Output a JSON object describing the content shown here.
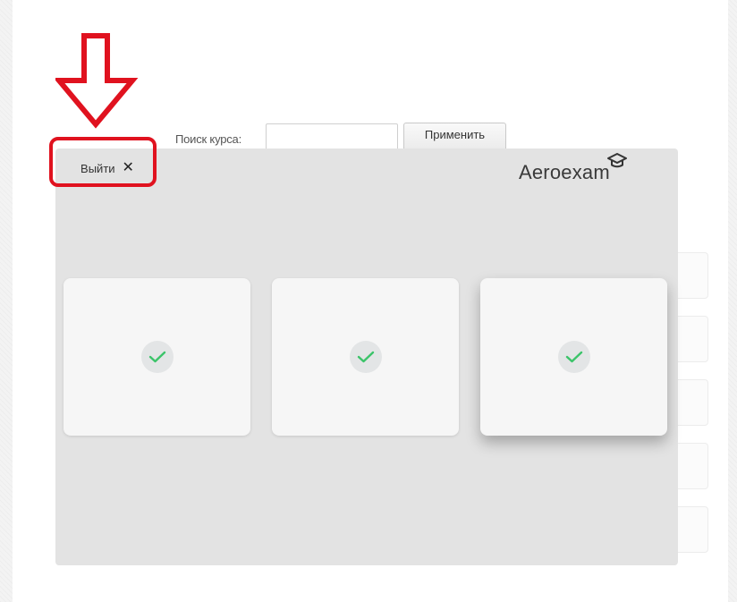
{
  "search": {
    "label": "Поиск курса:",
    "value": "",
    "placeholder": "",
    "apply_label": "Применить"
  },
  "overlay": {
    "exit_label": "Выйти",
    "close_glyph": "✕",
    "logo_text": "Aeroexam",
    "logo_icon": "graduation-cap-icon"
  },
  "cards": [
    {
      "status_icon": "check-icon",
      "completed": true
    },
    {
      "status_icon": "check-icon",
      "completed": true
    },
    {
      "status_icon": "check-icon",
      "completed": true,
      "highlighted": true
    }
  ],
  "annotation": {
    "arrow_icon": "down-arrow-outline-icon",
    "color": "#e0121f"
  },
  "colors": {
    "check": "#3cc46a",
    "overlay_bg": "#e3e3e3",
    "card_bg": "#f6f6f6"
  }
}
